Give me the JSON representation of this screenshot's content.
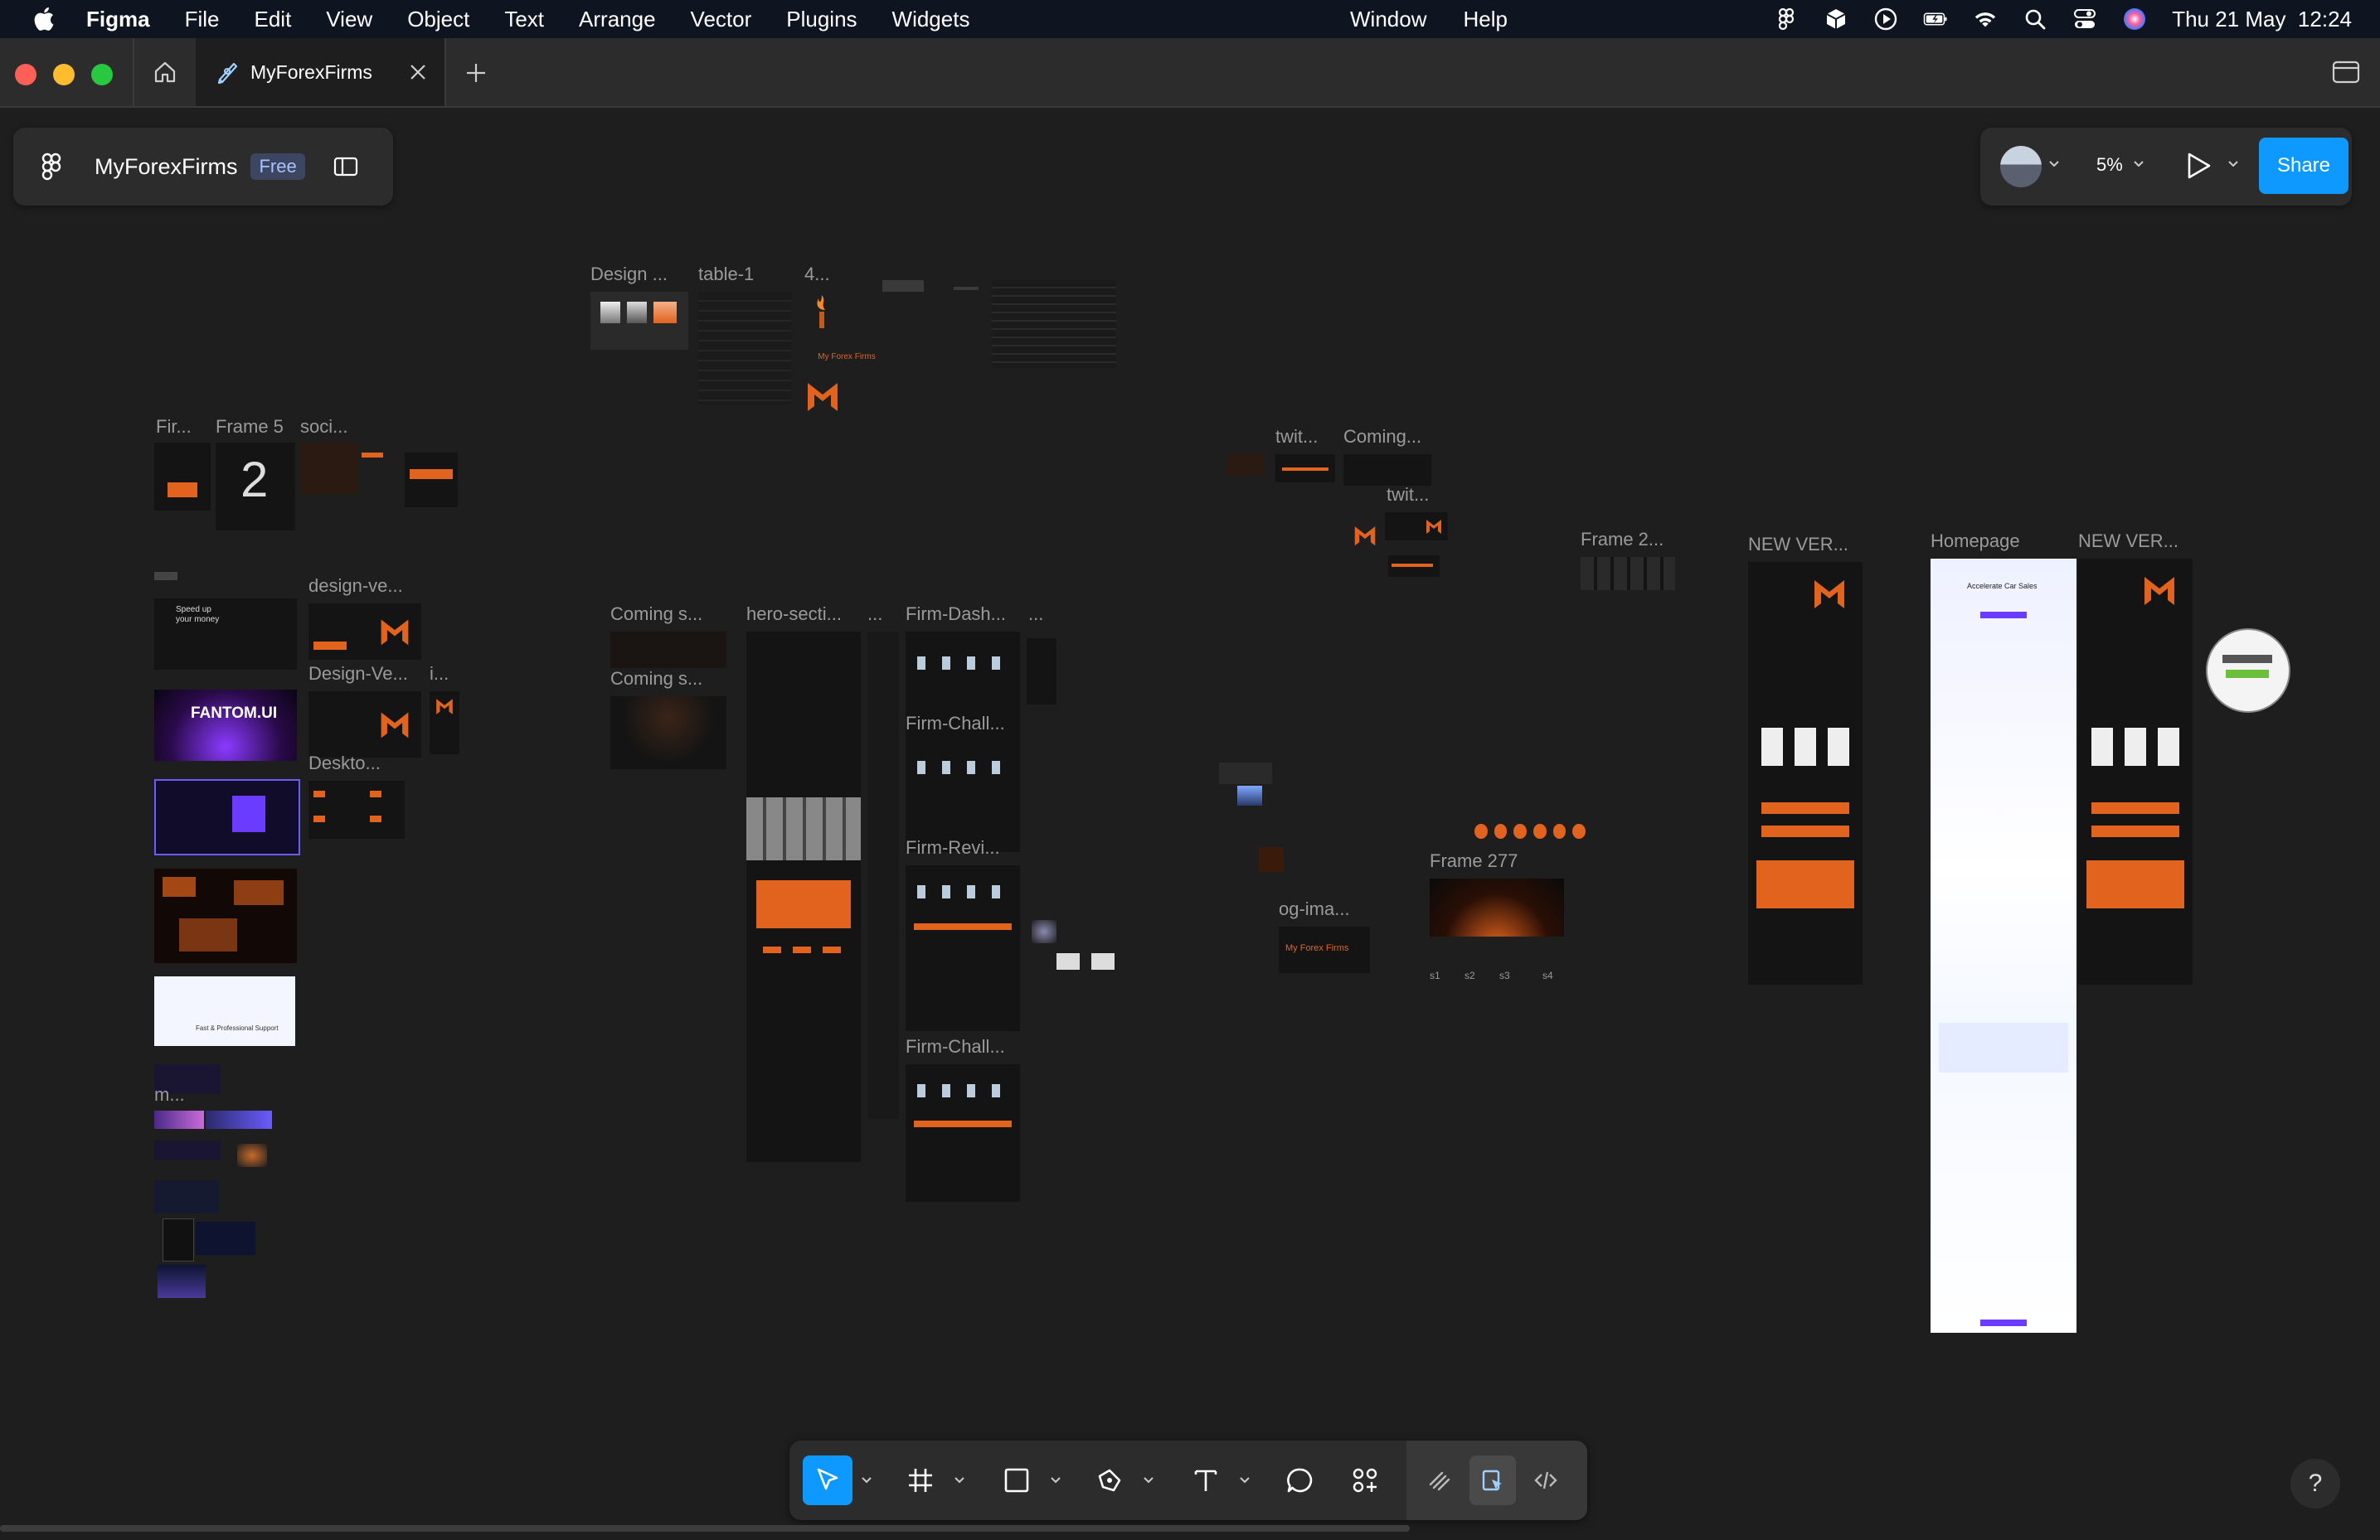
{
  "menubar": {
    "app_name": "Figma",
    "items": [
      "File",
      "Edit",
      "View",
      "Object",
      "Text",
      "Arrange",
      "Vector",
      "Plugins",
      "Widgets"
    ],
    "right_items": [
      "Window",
      "Help"
    ],
    "datetime": "Thu 21 May  12:24"
  },
  "tabbar": {
    "tab_title": "MyForexFirms"
  },
  "file_panel": {
    "file_name": "MyForexFirms",
    "plan_badge": "Free"
  },
  "right_panel": {
    "zoom": "5%",
    "share_label": "Share"
  },
  "canvas": {
    "frame_labels": {
      "design_top": "Design ...",
      "table1": "table-1",
      "four": "4...",
      "fir": "Fir...",
      "frame5": "Frame 5",
      "soci": "soci...",
      "design_ve": "design-ve...",
      "design_ve2": "Design-Ve...",
      "i": "i...",
      "deskto": "Deskto...",
      "coming_s1": "Coming s...",
      "coming_s2": "Coming s...",
      "hero_secti": "hero-secti...",
      "dots1": "...",
      "firm_dash": "Firm-Dash...",
      "dots2": "...",
      "firm_chall1": "Firm-Chall...",
      "firm_revi": "Firm-Revi...",
      "firm_chall2": "Firm-Chall...",
      "twit1": "twit...",
      "coming_top": "Coming...",
      "twit2": "twit...",
      "frame2": "Frame 2...",
      "new_ver1": "NEW VER...",
      "homepage": "Homepage",
      "new_ver2": "NEW VER...",
      "frame277": "Frame 277",
      "og_ima": "og-ima...",
      "m": "m...",
      "s1": "s1",
      "s2": "s2",
      "s3": "s3",
      "s4": "s4"
    },
    "thumb_text": {
      "fantom": "FANTOM.UI",
      "speed": "Speed up your money",
      "my_forex": "My Forex Firms",
      "accelerate": "Accelerate Car Sales",
      "fast_support": "Fast & Professional Support"
    }
  },
  "toolbar": {
    "tools": [
      "move-tool",
      "frame-tool",
      "shape-tool",
      "pen-tool",
      "text-tool",
      "comment-tool",
      "actions-tool",
      "draw-mode",
      "design-mode",
      "dev-mode"
    ]
  },
  "help_label": "?"
}
